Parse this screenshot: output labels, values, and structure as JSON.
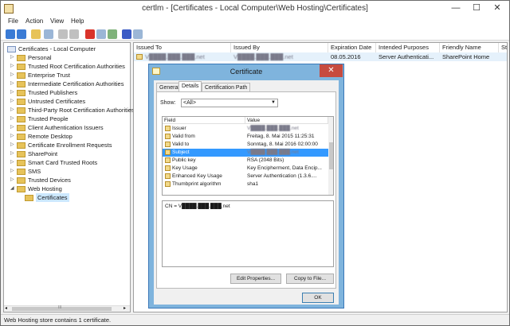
{
  "window": {
    "title": "certlm - [Certificates - Local Computer\\Web Hosting\\Certificates]",
    "minimize": "—",
    "maximize": "☐",
    "close": "✕"
  },
  "menu": {
    "file": "File",
    "action": "Action",
    "view": "View",
    "help": "Help"
  },
  "tree": {
    "root": "Certificates - Local Computer",
    "items": [
      "Personal",
      "Trusted Root Certification Authorities",
      "Enterprise Trust",
      "Intermediate Certification Authorities",
      "Trusted Publishers",
      "Untrusted Certificates",
      "Third-Party Root Certification Authorities",
      "Trusted People",
      "Client Authentication Issuers",
      "Remote Desktop",
      "Certificate Enrollment Requests",
      "SharePoint",
      "Smart Card Trusted Roots",
      "SMS",
      "Trusted Devices",
      "Web Hosting"
    ],
    "child": "Certificates",
    "scroll_left": "◂",
    "scroll_mid": "III",
    "scroll_right": "▸"
  },
  "list": {
    "columns": {
      "issued_to": "Issued To",
      "issued_by": "Issued By",
      "expiration": "Expiration Date",
      "purposes": "Intended Purposes",
      "friendly": "Friendly Name",
      "status": "Sta"
    },
    "row": {
      "issued_to": "V████.███.███.net",
      "issued_by": "V████.███.███.net",
      "expiration": "08.05.2016",
      "purposes": "Server Authenticati...",
      "friendly": "SharePoint Home"
    }
  },
  "status": "Web Hosting store contains 1 certificate.",
  "dialog": {
    "title": "Certificate",
    "close": "✕",
    "tabs": {
      "general": "General",
      "details": "Details",
      "path": "Certification Path"
    },
    "show_label": "Show:",
    "show_value": "<All>",
    "field_header": "Field",
    "value_header": "Value",
    "fields": [
      {
        "name": "Issuer",
        "value": "V████.███.███.net"
      },
      {
        "name": "Valid from",
        "value": "Freitag, 8. Mai 2015 11:25:31"
      },
      {
        "name": "Valid to",
        "value": "Sonntag, 8. Mai 2016 02:00:00"
      },
      {
        "name": "Subject",
        "value": "V████.███.███.net"
      },
      {
        "name": "Public key",
        "value": "RSA (2048 Bits)"
      },
      {
        "name": "Key Usage",
        "value": "Key Encipherment, Data Encip..."
      },
      {
        "name": "Enhanced Key Usage",
        "value": "Server Authentication (1.3.6...."
      },
      {
        "name": "Thumbprint algorithm",
        "value": "sha1"
      }
    ],
    "detail_text": "CN = V████.███.███.net",
    "edit_button": "Edit Properties...",
    "copy_button": "Copy to File...",
    "ok_button": "OK"
  },
  "colors": {
    "selection": "#3399ff",
    "dialog_frame": "#7fb4dd",
    "close_red": "#c74b3f"
  }
}
